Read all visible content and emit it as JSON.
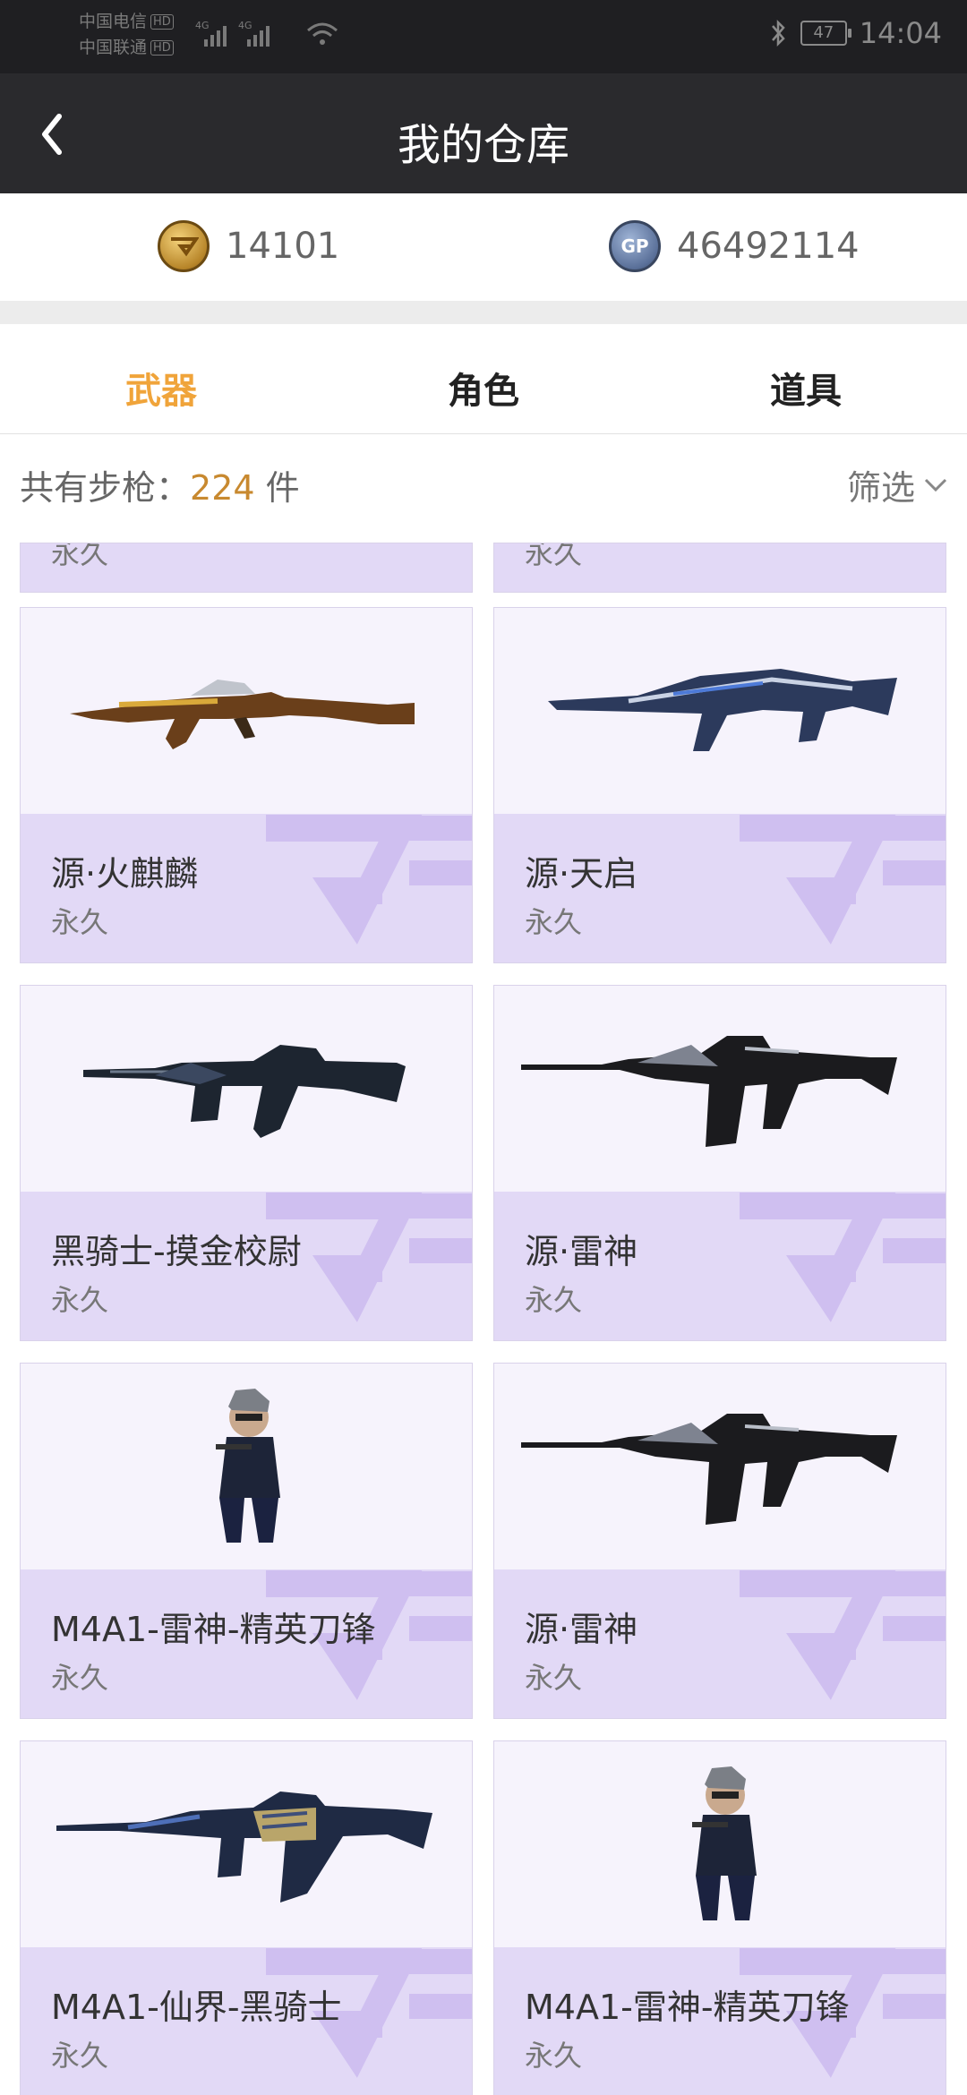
{
  "status_bar": {
    "carrier1": "中国电信",
    "carrier2": "中国联通",
    "hd_badge": "HD",
    "net1": "4G",
    "net2": "4G",
    "battery": "47",
    "time": "14:04"
  },
  "header": {
    "title": "我的仓库"
  },
  "currency": {
    "cf_points": "14101",
    "gp_points": "46492114",
    "gp_label": "GP"
  },
  "tabs": [
    {
      "label": "武器",
      "active": true
    },
    {
      "label": "角色",
      "active": false
    },
    {
      "label": "道具",
      "active": false
    }
  ],
  "summary": {
    "label": "共有步枪：",
    "count": "224",
    "unit": " 件",
    "filter_label": "筛选"
  },
  "items": [
    {
      "name": "",
      "duration": "永久"
    },
    {
      "name": "",
      "duration": "永久"
    },
    {
      "name": "源·火麒麟",
      "duration": "永久"
    },
    {
      "name": "源·天启",
      "duration": "永久"
    },
    {
      "name": "黑骑士-摸金校尉",
      "duration": "永久"
    },
    {
      "name": "源·雷神",
      "duration": "永久"
    },
    {
      "name": "M4A1-雷神-精英刀锋",
      "duration": "永久"
    },
    {
      "name": "源·雷神",
      "duration": "永久"
    },
    {
      "name": "M4A1-仙界-黑骑士",
      "duration": "永久"
    },
    {
      "name": "M4A1-雷神-精英刀锋",
      "duration": "永久"
    }
  ]
}
